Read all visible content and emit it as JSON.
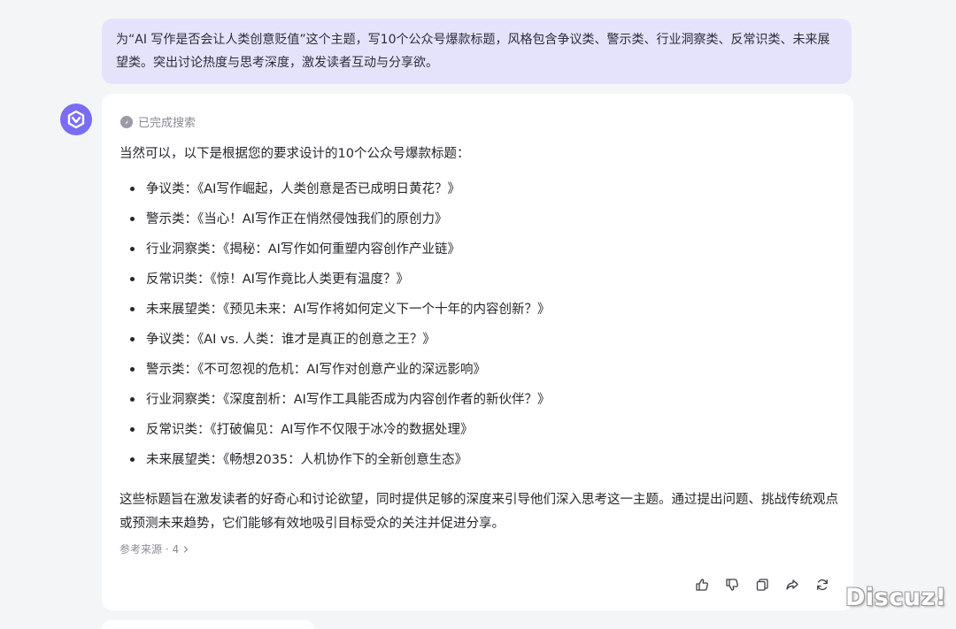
{
  "user_message": {
    "text": "为“AI 写作是否会让人类创意贬值”这个主题，写10个公众号爆款标题，风格包含争议类、警示类、行业洞察类、反常识类、未来展望类。突出讨论热度与思考深度，激发读者互动与分享欲。"
  },
  "assistant": {
    "avatar_icon": "assistant-logo-icon",
    "search_status": "已完成搜索",
    "intro": "当然可以，以下是根据您的要求设计的10个公众号爆款标题：",
    "headlines": [
      "争议类：《AI写作崛起，人类创意是否已成明日黄花？》",
      "警示类：《当心！AI写作正在悄然侵蚀我们的原创力》",
      "行业洞察类：《揭秘：AI写作如何重塑内容创作产业链》",
      "反常识类：《惊！AI写作竟比人类更有温度？》",
      "未来展望类：《预见未来：AI写作将如何定义下一个十年的内容创新？》",
      "争议类：《AI vs. 人类：谁才是真正的创意之王？》",
      "警示类：《不可忽视的危机：AI写作对创意产业的深远影响》",
      "行业洞察类：《深度剖析：AI写作工具能否成为内容创作者的新伙伴？》",
      "反常识类：《打破偏见：AI写作不仅限于冰冷的数据处理》",
      "未来展望类：《畅想2035：人机协作下的全新创意生态》"
    ],
    "summary": "这些标题旨在激发读者的好奇心和讨论欲望，同时提供足够的深度来引导他们深入思考这一主题。通过提出问题、挑战传统观点或预测未来趋势，它们能够有效地吸引目标受众的关注并促进分享。",
    "sources_label": "参考来源 · 4",
    "actions": [
      "thumbs-up-icon",
      "thumbs-down-icon",
      "copy-icon",
      "share-icon",
      "regenerate-icon"
    ]
  },
  "watermark": "Discuz!",
  "colors": {
    "background": "#f4f5f7",
    "user_bubble": "#e5e3fb",
    "accent": "#7b6df2",
    "card": "#ffffff"
  }
}
